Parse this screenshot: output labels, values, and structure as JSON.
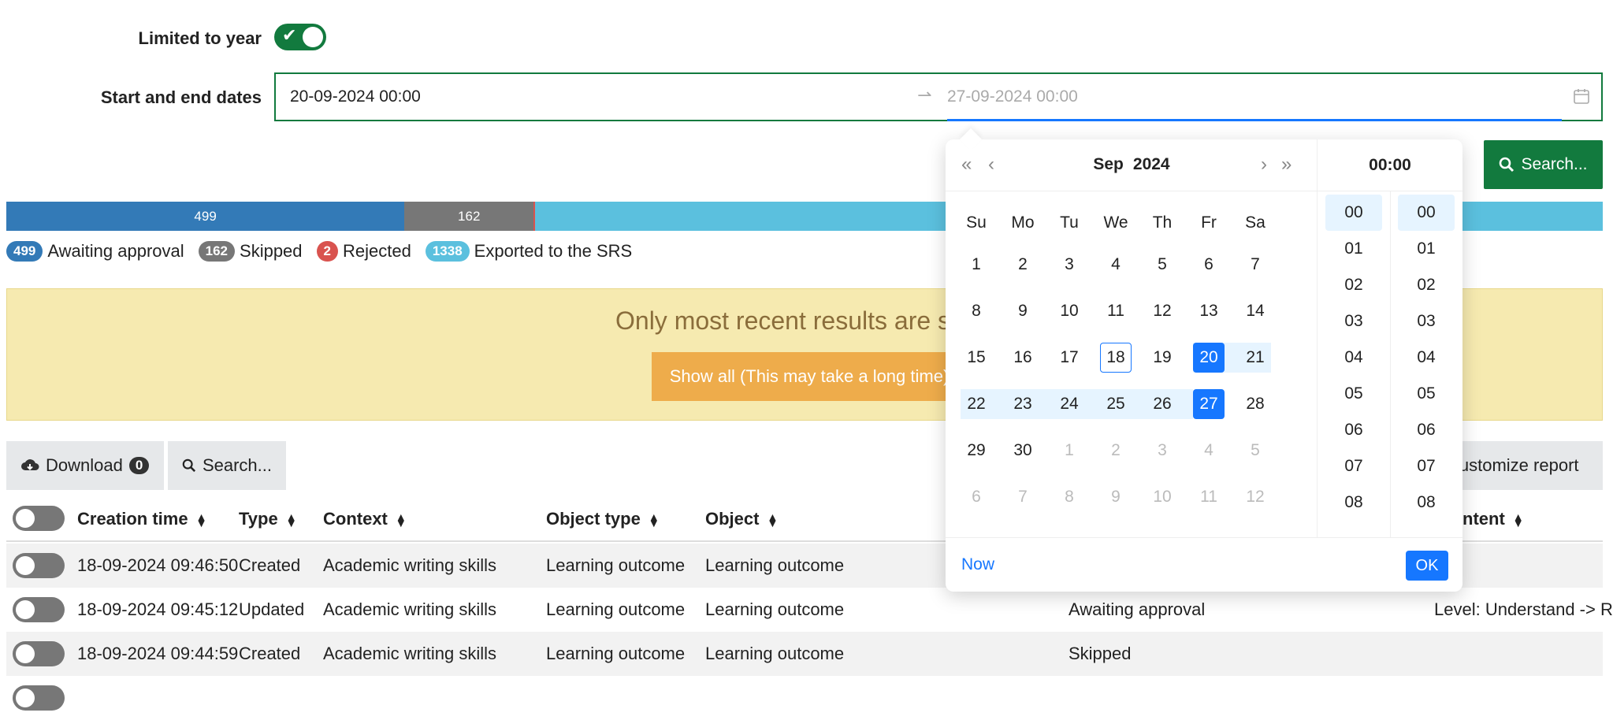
{
  "form": {
    "limited_label": "Limited to year",
    "limited_on": true,
    "dates_label": "Start and end dates",
    "start_value": "20-09-2024 00:00",
    "end_placeholder": "27-09-2024 00:00",
    "search_label": "Search..."
  },
  "progress": {
    "segments": [
      {
        "label": "499",
        "value": 499,
        "color": "#337ab7"
      },
      {
        "label": "162",
        "value": 162,
        "color": "#777777"
      },
      {
        "label": "",
        "value": 2,
        "color": "#d9534f"
      },
      {
        "label": "",
        "value": 1338,
        "color": "#5bc0de"
      }
    ]
  },
  "legend": [
    {
      "count": "499",
      "label": "Awaiting approval",
      "color": "#337ab7"
    },
    {
      "count": "162",
      "label": "Skipped",
      "color": "#777777"
    },
    {
      "count": "2",
      "label": "Rejected",
      "color": "#d9534f"
    },
    {
      "count": "1338",
      "label": "Exported to the SRS",
      "color": "#5bc0de"
    }
  ],
  "alert": {
    "message": "Only most recent results are sh",
    "button": "Show all (This may take a long time)"
  },
  "toolbar": {
    "download_label": "Download",
    "download_count": "0",
    "search_label": "Search...",
    "customize_label": "Customize report"
  },
  "table": {
    "headers": {
      "creation_time": "Creation time",
      "type": "Type",
      "context": "Context",
      "object_type": "Object type",
      "object": "Object",
      "content": "ntent"
    },
    "rows": [
      {
        "time": "18-09-2024 09:46:50",
        "type": "Created",
        "context": "Academic writing skills",
        "object_type": "Learning outcome",
        "object": "Learning outcome",
        "status": "",
        "content": ""
      },
      {
        "time": "18-09-2024 09:45:12",
        "type": "Updated",
        "context": "Academic writing skills",
        "object_type": "Learning outcome",
        "object": "Learning outcome",
        "status": "Awaiting approval",
        "content": "Level: Understand -> R"
      },
      {
        "time": "18-09-2024 09:44:59",
        "type": "Created",
        "context": "Academic writing skills",
        "object_type": "Learning outcome",
        "object": "Learning outcome",
        "status": "Skipped",
        "content": ""
      }
    ]
  },
  "picker": {
    "month": "Sep",
    "year": "2024",
    "time_header": "00:00",
    "weekdays": [
      "Su",
      "Mo",
      "Tu",
      "We",
      "Th",
      "Fr",
      "Sa"
    ],
    "weeks": [
      [
        "1",
        "2",
        "3",
        "4",
        "5",
        "6",
        "7"
      ],
      [
        "8",
        "9",
        "10",
        "11",
        "12",
        "13",
        "14"
      ],
      [
        "15",
        "16",
        "17",
        "18",
        "19",
        "20",
        "21"
      ],
      [
        "22",
        "23",
        "24",
        "25",
        "26",
        "27",
        "28"
      ],
      [
        "29",
        "30",
        "1",
        "2",
        "3",
        "4",
        "5"
      ],
      [
        "6",
        "7",
        "8",
        "9",
        "10",
        "11",
        "12"
      ]
    ],
    "hours": [
      "00",
      "01",
      "02",
      "03",
      "04",
      "05",
      "06",
      "07",
      "08"
    ],
    "minutes": [
      "00",
      "01",
      "02",
      "03",
      "04",
      "05",
      "06",
      "07",
      "08"
    ],
    "now_label": "Now",
    "ok_label": "OK"
  }
}
